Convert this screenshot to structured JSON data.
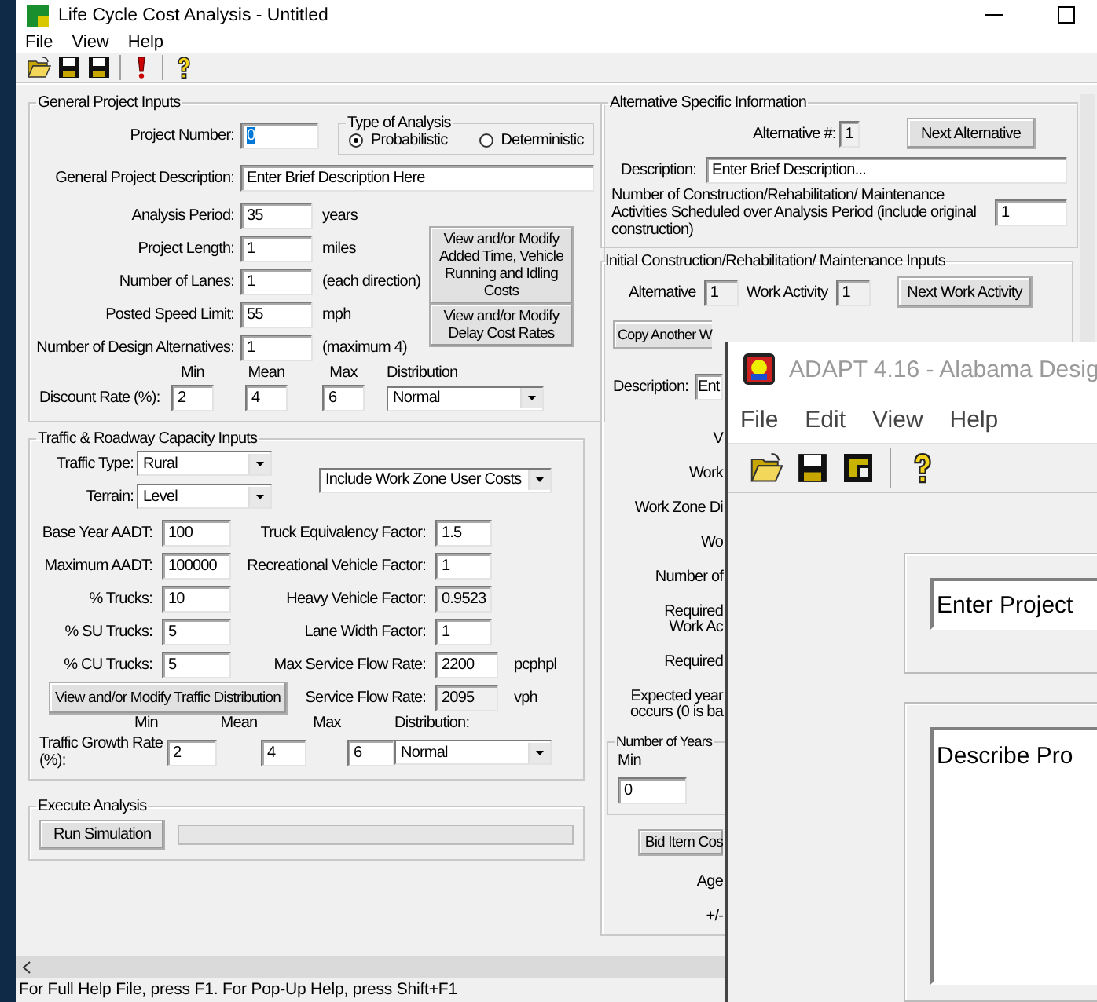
{
  "window": {
    "title": "Life Cycle Cost Analysis - Untitled",
    "menu": [
      "File",
      "View",
      "Help"
    ]
  },
  "general": {
    "title": "General Project Inputs",
    "project_number": {
      "label": "Project Number:",
      "value": "0",
      "highlighted": true
    },
    "analysis_type": {
      "title": "Type of Analysis",
      "options": [
        {
          "label": "Probabilistic",
          "selected": true
        },
        {
          "label": "Deterministic",
          "selected": false
        }
      ]
    },
    "description": {
      "label": "General Project Description:",
      "value": "Enter Brief Description Here"
    },
    "rows": [
      {
        "label": "Analysis Period:",
        "value": "35",
        "unit": "years"
      },
      {
        "label": "Project Length:",
        "value": "1",
        "unit": "miles"
      },
      {
        "label": "Number of Lanes:",
        "value": "1",
        "unit": "(each direction)"
      },
      {
        "label": "Posted Speed Limit:",
        "value": "55",
        "unit": "mph"
      },
      {
        "label": "Number of Design Alternatives:",
        "value": "1",
        "unit": "(maximum 4)"
      }
    ],
    "buttons": [
      "View and/or Modify Added Time, Vehicle Running and Idling Costs",
      "View and/or Modify Delay Cost Rates"
    ],
    "range_headers": [
      "Min",
      "Mean",
      "Max",
      "Distribution"
    ],
    "discount": {
      "label": "Discount Rate (%):",
      "min": "2",
      "mean": "4",
      "max": "6",
      "distribution": "Normal"
    }
  },
  "traffic": {
    "title": "Traffic  & Roadway Capacity Inputs",
    "traffic_type": {
      "label": "Traffic Type:",
      "value": "Rural"
    },
    "terrain": {
      "label": "Terrain:",
      "value": "Level"
    },
    "user_costs": "Include Work Zone User Costs",
    "left_rows": [
      {
        "label": "Base Year AADT:",
        "value": "100"
      },
      {
        "label": "Maximum AADT:",
        "value": "100000"
      },
      {
        "label": "% Trucks:",
        "value": "10"
      },
      {
        "label": "% SU Trucks:",
        "value": "5"
      },
      {
        "label": "% CU Trucks:",
        "value": "5"
      }
    ],
    "right_rows": [
      {
        "label": "Truck Equivalency Factor:",
        "value": "1.5",
        "readonly": false
      },
      {
        "label": "Recreational Vehicle Factor:",
        "value": "1",
        "readonly": false
      },
      {
        "label": "Heavy Vehicle Factor:",
        "value": "0.9523",
        "readonly": true
      },
      {
        "label": "Lane Width Factor:",
        "value": "1",
        "readonly": false
      },
      {
        "label": "Max Service Flow Rate:",
        "value": "2200",
        "unit": "pcphpl",
        "readonly": false
      },
      {
        "label": "Service Flow Rate:",
        "value": "2095",
        "unit": "vph",
        "readonly": true
      }
    ],
    "distribution_button": "View and/or Modify Traffic Distribution",
    "range_headers": [
      "Min",
      "Mean",
      "Max",
      "Distribution:"
    ],
    "growth": {
      "label": "Traffic Growth Rate (%):",
      "min": "2",
      "mean": "4",
      "max": "6",
      "distribution": "Normal"
    }
  },
  "execute": {
    "title": "Execute Analysis",
    "button": "Run Simulation",
    "progress": {
      "level": 0
    }
  },
  "alternative_info": {
    "title": "Alternative Specific Information",
    "alternative": {
      "label": "Alternative #:",
      "value": "1"
    },
    "next_button": "Next Alternative",
    "description": {
      "label": "Description:",
      "value": "Enter Brief Description..."
    },
    "activities": {
      "label": "Number of Construction/Rehabilitation/ Maintenance Activities Scheduled over Analysis Period (include original construction)",
      "value": "1"
    }
  },
  "initial_inputs": {
    "title": "Initial Construction/Rehabilitation/ Maintenance Inputs",
    "alternative": {
      "label": "Alternative",
      "value": "1"
    },
    "work_activity": {
      "label": "Work Activity",
      "value": "1"
    },
    "next_button": "Next Work Activity",
    "copy_button": "Copy Another W",
    "description": {
      "label": "Description:",
      "value": "Ent"
    },
    "labels": [
      {
        "lines": [
          "V"
        ]
      },
      {
        "lines": [
          "Work"
        ]
      },
      {
        "lines": [
          "Work Zone Di"
        ]
      },
      {
        "lines": [
          "Wo"
        ]
      },
      {
        "lines": [
          "Number of"
        ]
      },
      {
        "lines": [
          "Required",
          "Work Ac"
        ]
      },
      {
        "lines": [
          "Required"
        ]
      },
      {
        "lines": [
          "Expected year",
          "occurs (0 is ba"
        ]
      }
    ],
    "years_group": {
      "title": "Number of Years",
      "label": "Min",
      "value": "0"
    },
    "bid_button": "Bid Item Cos",
    "bottom_labels": [
      "Age",
      "+/-"
    ]
  },
  "status_bar": "For Full Help File, press F1.  For Pop-Up Help, press Shift+F1",
  "adapt_window": {
    "title": "ADAPT 4.16 - Alabama Desig",
    "menu": [
      "File",
      "Edit",
      "View",
      "Help"
    ],
    "project_field": "Enter Project",
    "description_field": "Describe Pro"
  }
}
